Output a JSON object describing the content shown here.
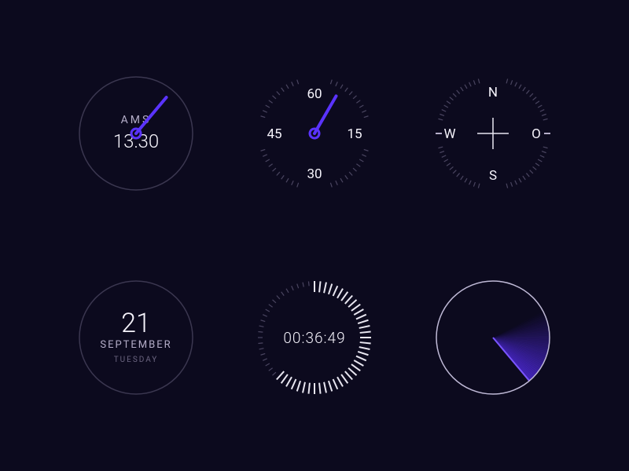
{
  "accent_color": "#5a33ff",
  "worldclock": {
    "city_code": "AMS",
    "time": "13:30",
    "hand_angle_deg": 40
  },
  "seconds_dial": {
    "n": "60",
    "e": "15",
    "s": "30",
    "w": "45",
    "hand_angle_deg": 30
  },
  "compass": {
    "n": "N",
    "e": "O",
    "s": "S",
    "w": "W"
  },
  "datecard": {
    "day": "21",
    "month": "SEPTEMBER",
    "weekday": "TUESDAY"
  },
  "timer": {
    "elapsed": "00:36:49",
    "progress_frac": 0.62
  },
  "radar": {
    "sweep_angle_deg": 140
  }
}
